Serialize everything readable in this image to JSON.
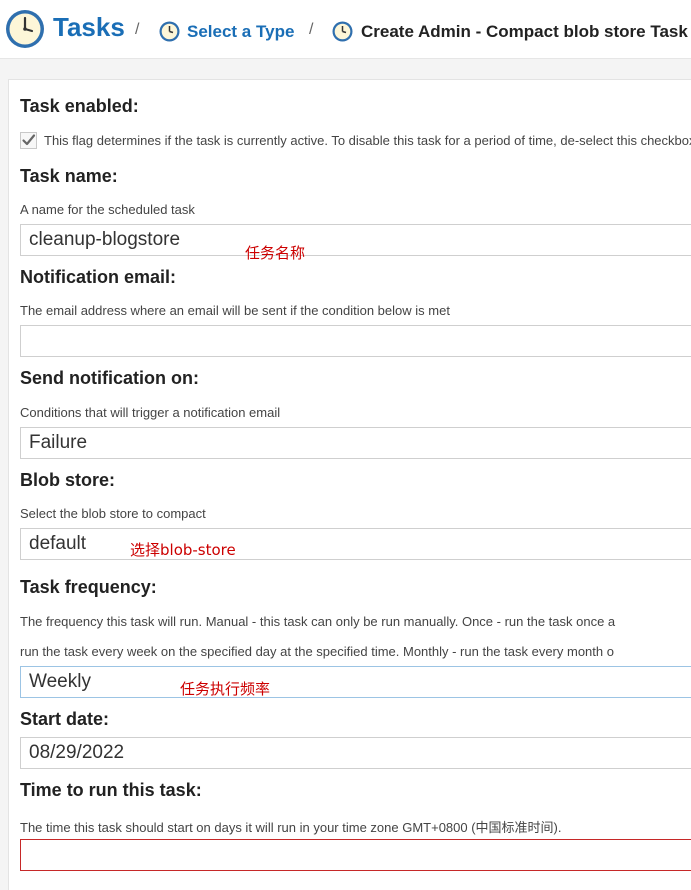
{
  "breadcrumb": {
    "root": "Tasks",
    "separator": "/",
    "step1": "Select a Type",
    "current": "Create Admin - Compact blob store Task"
  },
  "form": {
    "enabled": {
      "label": "Task enabled:",
      "help": "This flag determines if the task is currently active. To disable this task for a period of time, de-select this checkbox",
      "checked": true
    },
    "name": {
      "label": "Task name:",
      "help": "A name for the scheduled task",
      "value": "cleanup-blogstore",
      "annotation": "任务名称"
    },
    "email": {
      "label": "Notification email:",
      "help": "The email address where an email will be sent if the condition below is met",
      "value": ""
    },
    "notify": {
      "label": "Send notification on:",
      "help": "Conditions that will trigger a notification email",
      "value": "Failure"
    },
    "blobstore": {
      "label": "Blob store:",
      "help": "Select the blob store to compact",
      "value": "default",
      "annotation": "选择blob-store"
    },
    "frequency": {
      "label": "Task frequency:",
      "help_line1": "The frequency this task will run. Manual - this task can only be run manually. Once - run the task once a",
      "help_line2": "run the task every week on the specified day at the specified time. Monthly - run the task every month o",
      "value": "Weekly",
      "annotation": "任务执行频率"
    },
    "start_date": {
      "label": "Start date:",
      "value": "08/29/2022"
    },
    "time": {
      "label": "Time to run this task:",
      "help": "The time this task should start on days it will run in your time zone GMT+0800 (中国标准时间).",
      "value": ""
    }
  },
  "icons": {
    "clock": "clock-icon",
    "checkbox": "checkbox-icon"
  }
}
